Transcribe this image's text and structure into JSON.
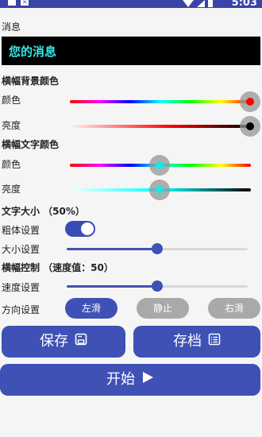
{
  "status_bar": {
    "time": "5:03"
  },
  "message": {
    "section_label": "消息",
    "text": "您的消息"
  },
  "banner_bg": {
    "title": "横幅背景颜色",
    "color_label": "颜色",
    "brightness_label": "亮度",
    "color_value": 1.0,
    "brightness_value": 1.0
  },
  "banner_text": {
    "title": "横幅文字颜色",
    "color_label": "颜色",
    "brightness_label": "亮度",
    "color_value": 0.5,
    "brightness_value": 0.5
  },
  "text_size": {
    "title": "文字大小 （50%）",
    "percent": 50
  },
  "bold": {
    "label": "粗体设置",
    "on": true
  },
  "size": {
    "label": "大小设置",
    "value": 0.5
  },
  "banner_control": {
    "title": "横幅控制 （速度值：50）",
    "speed": 50
  },
  "speed": {
    "label": "速度设置",
    "value": 0.5
  },
  "direction": {
    "label": "方向设置",
    "options": [
      "左滑",
      "静止",
      "右滑"
    ],
    "selected": "左滑"
  },
  "buttons": {
    "save": "保存",
    "archive": "存档",
    "start": "开始"
  },
  "colors": {
    "accent": "#3f51b5",
    "status_bar": "#3a43a8",
    "message_text": "#34e6e6",
    "idle": "#a9a9a9"
  },
  "icons": [
    "save-icon",
    "list-icon",
    "play-icon"
  ]
}
